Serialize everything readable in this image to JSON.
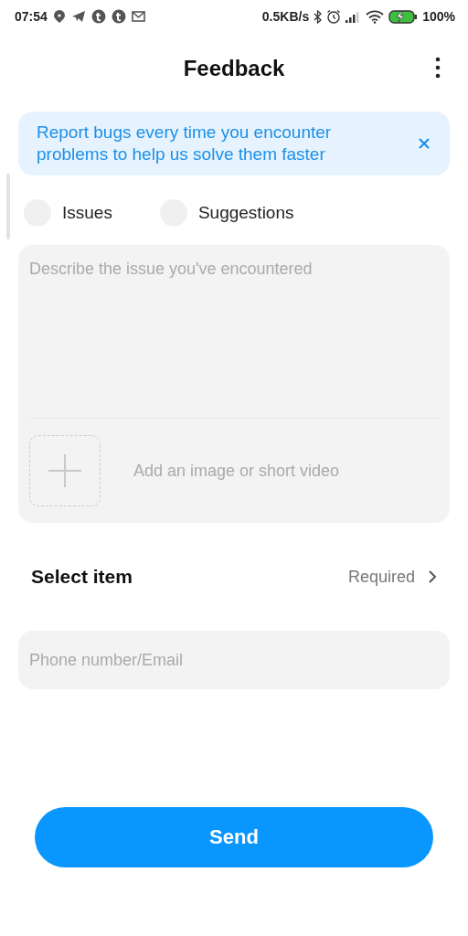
{
  "status_bar": {
    "time": "07:54",
    "speed": "0.5KB/s",
    "battery": "100%"
  },
  "header": {
    "title": "Feedback"
  },
  "banner": {
    "text": "Report bugs every time you encounter problems to help us solve them faster"
  },
  "feedback_types": [
    {
      "label": "Issues",
      "selected": false
    },
    {
      "label": "Suggestions",
      "selected": false
    }
  ],
  "description": {
    "placeholder": "Describe the issue you've encountered",
    "attachment_label": "Add an image or short video"
  },
  "select_item": {
    "label": "Select item",
    "value": "Required"
  },
  "contact": {
    "placeholder": "Phone number/Email"
  },
  "send_button": "Send"
}
